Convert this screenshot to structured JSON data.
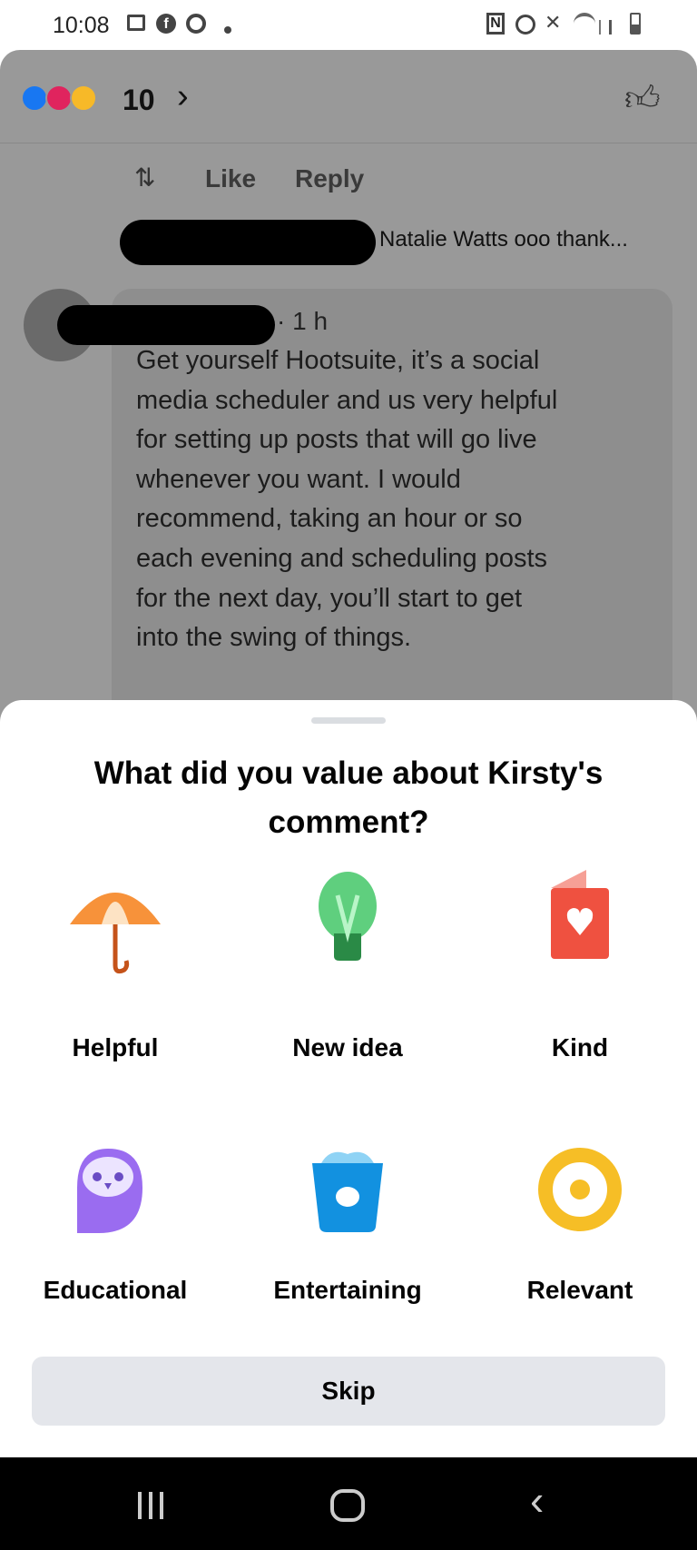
{
  "status_bar": {
    "time": "10:08",
    "left_icons": [
      "gallery-icon",
      "facebook-icon",
      "chrome-icon",
      "dot-icon"
    ],
    "right_icons": [
      "nfc-icon",
      "alarm-icon",
      "mute-icon",
      "wifi-icon",
      "signal-icon",
      "battery-icon"
    ]
  },
  "reactions": {
    "count": "10",
    "icons": [
      "like-reaction",
      "love-reaction",
      "care-reaction"
    ]
  },
  "previous_comment": {
    "like_label": "Like",
    "reply_label": "Reply",
    "reply_preview": "Natalie Watts ooo thank..."
  },
  "comment": {
    "time": "· 1 h",
    "text": [
      "Get yourself Hootsuite, it’s a social",
      "media scheduler and us very helpful",
      "for setting up posts that will go live",
      "whenever you want.  I would",
      "recommend, taking an hour or so",
      "each evening and scheduling posts",
      "for the next day, you’ll start to get",
      "into the swing of things."
    ]
  },
  "sheet": {
    "title_line1": "What did you value about Kirsty's",
    "title_line2": "comment?",
    "options": [
      {
        "label": "Helpful",
        "icon": "umbrella-icon"
      },
      {
        "label": "New idea",
        "icon": "lightbulb-icon"
      },
      {
        "label": "Kind",
        "icon": "card-heart-icon"
      },
      {
        "label": "Educational",
        "icon": "owl-icon"
      },
      {
        "label": "Entertaining",
        "icon": "popcorn-bucket-icon"
      },
      {
        "label": "Relevant",
        "icon": "target-icon"
      }
    ],
    "skip_label": "Skip"
  },
  "colors": {
    "overlay": "#999999",
    "sheet": "#ffffff",
    "skip_bg": "#e4e6eb",
    "nav": "#000000"
  }
}
